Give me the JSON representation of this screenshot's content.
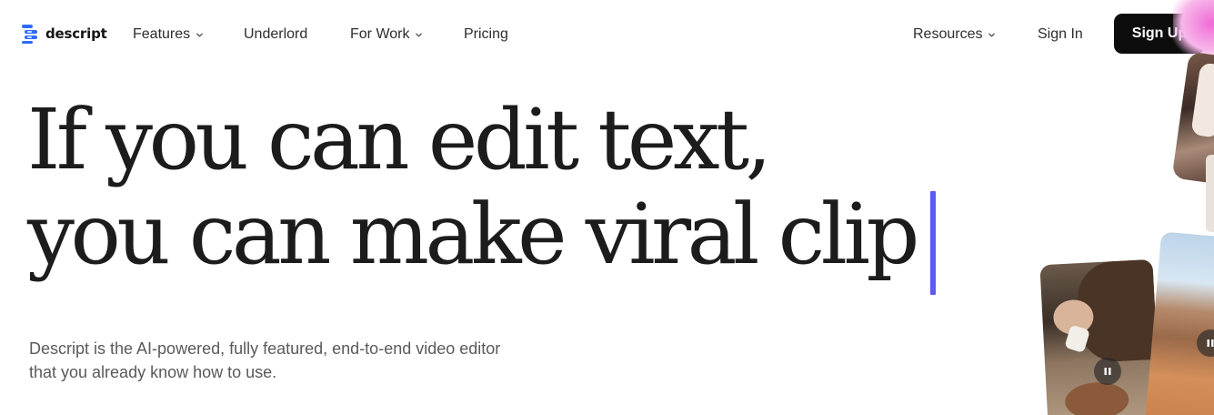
{
  "brand": {
    "name": "descript",
    "accent": "#5a5cf0",
    "logo_color": "#2f6bff"
  },
  "nav": {
    "items": [
      {
        "label": "Features",
        "has_dropdown": true,
        "icon": "chevron-down-icon"
      },
      {
        "label": "Underlord",
        "has_dropdown": false
      },
      {
        "label": "For Work",
        "has_dropdown": true,
        "icon": "chevron-down-icon"
      },
      {
        "label": "Pricing",
        "has_dropdown": false
      }
    ],
    "right_items": [
      {
        "label": "Resources",
        "has_dropdown": true,
        "icon": "chevron-down-icon"
      },
      {
        "label": "Sign In",
        "has_dropdown": false
      }
    ],
    "cta_label": "Sign Up"
  },
  "hero": {
    "headline_line1": "If you can edit text,",
    "headline_line2": "you can make viral clip",
    "subtext_line1": "Descript is the AI-powered, fully featured, end-to-end video editor",
    "subtext_line2": "that you already know how to use."
  },
  "media": {
    "video_cards": [
      {
        "icon": "pause-icon"
      },
      {
        "icon": "pause-icon"
      }
    ]
  }
}
